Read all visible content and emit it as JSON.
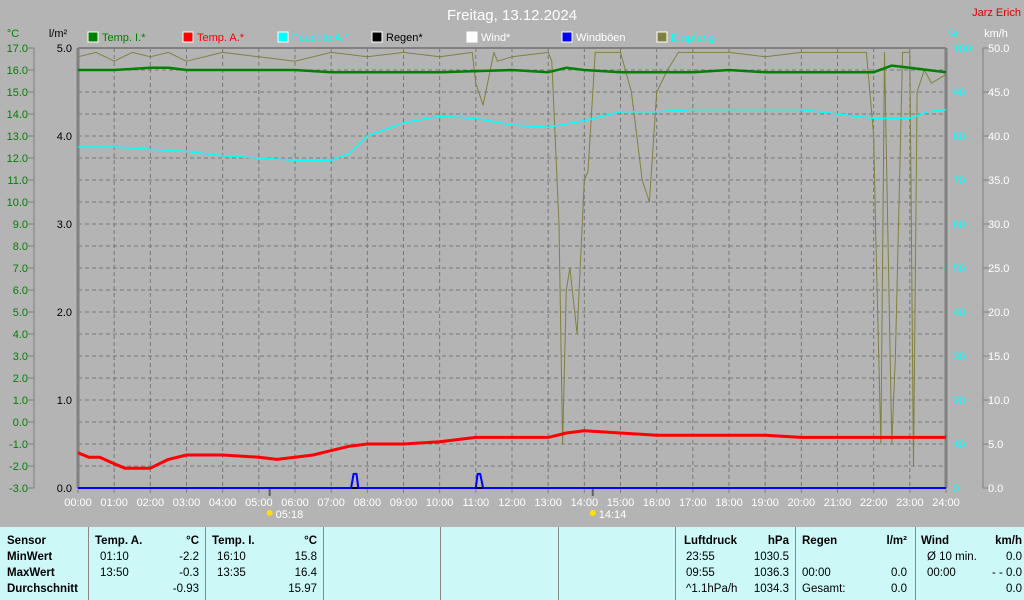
{
  "title": "Freitag, 13.12.2024",
  "author": "Jarz Erich",
  "colors": {
    "temp_i": "#008000",
    "temp_a": "#ff0000",
    "feuchte": "#00ffff",
    "regen": "#000000",
    "wind": "#ffffff",
    "windboeen": "#0000ff",
    "empfang": "#808040"
  },
  "chart_data": {
    "type": "line",
    "title": "Freitag, 13.12.2024",
    "x_range_hours": [
      0,
      24
    ],
    "x_ticks": [
      "00:00",
      "01:00",
      "02:00",
      "03:00",
      "04:00",
      "05:00",
      "06:00",
      "07:00",
      "08:00",
      "09:00",
      "10:00",
      "11:00",
      "12:00",
      "13:00",
      "14:00",
      "15:00",
      "16:00",
      "17:00",
      "18:00",
      "19:00",
      "20:00",
      "21:00",
      "22:00",
      "23:00",
      "24:00"
    ],
    "axes": {
      "temp": {
        "unit": "°C",
        "range": [
          -3,
          17
        ],
        "ticks": [
          "17.0",
          "16.0",
          "15.0",
          "14.0",
          "13.0",
          "12.0",
          "11.0",
          "10.0",
          "9.0",
          "8.0",
          "7.0",
          "6.0",
          "5.0",
          "4.0",
          "3.0",
          "2.0",
          "1.0",
          "0.0",
          "-1.0",
          "-2.0",
          "-3.0"
        ]
      },
      "rain": {
        "unit": "l/m²",
        "range": [
          0,
          5
        ],
        "ticks": [
          "5.0",
          "4.0",
          "3.0",
          "2.0",
          "1.0",
          "0.0"
        ]
      },
      "humidity": {
        "unit": "%",
        "range": [
          0,
          100
        ],
        "ticks": [
          "100",
          "90",
          "80",
          "70",
          "60",
          "50",
          "40",
          "30",
          "20",
          "10",
          "0"
        ]
      },
      "wind": {
        "unit": "km/h",
        "range": [
          0,
          50
        ],
        "ticks": [
          "50.0",
          "45.0",
          "40.0",
          "35.0",
          "30.0",
          "25.0",
          "20.0",
          "15.0",
          "10.0",
          "5.0",
          "0.0"
        ]
      }
    },
    "legend": [
      "Temp. I.*",
      "Temp. A.*",
      "Feuchte A.*",
      "Regen*",
      "Wind*",
      "Windböen",
      "Empfang"
    ],
    "sunrise": "05:18",
    "sunset": "14:14",
    "series": [
      {
        "name": "Temp. I.*",
        "axis": "temp",
        "x": [
          0,
          1,
          2,
          2.5,
          3,
          4,
          5,
          6,
          7,
          8,
          10,
          12,
          13,
          13.5,
          14,
          15,
          16,
          17,
          18,
          19,
          20,
          21,
          22,
          22.5,
          23,
          24
        ],
        "y": [
          16.0,
          16.0,
          16.1,
          16.1,
          16.0,
          16.0,
          16.0,
          16.0,
          15.9,
          15.9,
          15.9,
          16.0,
          15.9,
          16.1,
          16.0,
          15.9,
          15.9,
          15.9,
          16.0,
          15.9,
          15.9,
          15.9,
          15.9,
          16.2,
          16.1,
          15.9
        ]
      },
      {
        "name": "Temp. A.*",
        "axis": "temp",
        "x": [
          0,
          0.3,
          0.6,
          1,
          1.3,
          2,
          2.5,
          3,
          4,
          5,
          5.5,
          6,
          6.5,
          7,
          7.5,
          8,
          9,
          10,
          11,
          12,
          13,
          13.5,
          14,
          15,
          16,
          17,
          18,
          19,
          20,
          21,
          22,
          23,
          24
        ],
        "y": [
          -1.4,
          -1.6,
          -1.6,
          -1.9,
          -2.1,
          -2.1,
          -1.7,
          -1.5,
          -1.5,
          -1.6,
          -1.7,
          -1.6,
          -1.5,
          -1.3,
          -1.1,
          -1.0,
          -1.0,
          -0.9,
          -0.7,
          -0.7,
          -0.7,
          -0.5,
          -0.4,
          -0.5,
          -0.6,
          -0.6,
          -0.6,
          -0.6,
          -0.7,
          -0.7,
          -0.7,
          -0.7,
          -0.7
        ]
      },
      {
        "name": "Feuchte A.*",
        "axis": "humidity",
        "x": [
          0,
          1,
          2,
          3,
          4,
          5,
          6,
          7,
          7.5,
          8,
          9,
          10,
          11,
          12,
          13,
          14,
          15,
          16,
          17,
          18,
          19,
          20,
          21,
          22,
          23,
          23.5,
          24
        ],
        "y": [
          77.5,
          77.5,
          77,
          76.5,
          75.5,
          75,
          74.5,
          74.5,
          76,
          80,
          83,
          84.5,
          84,
          82.5,
          82,
          83.5,
          85.5,
          85.5,
          86,
          86,
          86,
          86,
          85,
          84,
          84,
          85.5,
          86
        ]
      },
      {
        "name": "Regen*",
        "axis": "rain",
        "x": [
          0,
          24
        ],
        "y": [
          0,
          0
        ]
      },
      {
        "name": "Wind*",
        "axis": "wind",
        "x": [
          0,
          24
        ],
        "y": [
          0,
          0
        ]
      },
      {
        "name": "Windböen",
        "axis": "wind",
        "x": [
          0,
          7.55,
          7.62,
          7.7,
          7.75,
          11.0,
          11.05,
          11.12,
          11.2,
          24
        ],
        "y": [
          0,
          0,
          1.6,
          1.6,
          0,
          0,
          1.6,
          1.6,
          0,
          0
        ]
      },
      {
        "name": "Empfang",
        "axis": "humidity",
        "x": [
          0,
          0.5,
          1,
          1.5,
          2,
          2.5,
          3,
          4,
          5,
          6,
          7,
          8,
          9,
          10,
          10.9,
          11,
          11.2,
          11.5,
          11.6,
          12,
          13,
          13.1,
          13.3,
          13.4,
          13.5,
          13.6,
          13.8,
          14,
          14.1,
          14.3,
          14.5,
          14.8,
          15,
          15.3,
          15.6,
          15.8,
          16,
          16.3,
          16.6,
          17,
          18,
          19,
          20,
          21,
          21.8,
          22,
          22.05,
          22.2,
          22.3,
          22.5,
          22.6,
          22.8,
          23,
          23.1,
          23.2,
          23.4,
          23.6,
          24
        ],
        "y": [
          98,
          99,
          97,
          99,
          98,
          99,
          97,
          99,
          98,
          97,
          99,
          98,
          99,
          98,
          99,
          92,
          87,
          99,
          97,
          98,
          99,
          97,
          60,
          10,
          45,
          50,
          35,
          70,
          72,
          99,
          99,
          99,
          99,
          90,
          70,
          65,
          90,
          95,
          99,
          99,
          99,
          98,
          99,
          99,
          99,
          80,
          60,
          10,
          99,
          10,
          30,
          99,
          99,
          5,
          90,
          95,
          92,
          94
        ]
      }
    ]
  },
  "table": {
    "sensor": {
      "header": "Sensor",
      "rows": [
        "MinWert",
        "MaxWert",
        "Durchschnitt"
      ]
    },
    "temp_a": {
      "header": "Temp. A.",
      "unit": "°C",
      "times": [
        "01:10",
        "13:50",
        ""
      ],
      "values": [
        "-2.2",
        "-0.3",
        "-0.93"
      ]
    },
    "temp_i": {
      "header": "Temp. I.",
      "unit": "°C",
      "times": [
        "16:10",
        "13:35",
        ""
      ],
      "values": [
        "15.8",
        "16.4",
        "15.97"
      ]
    },
    "luftdruck": {
      "header": "Luftdruck",
      "unit": "hPa",
      "times": [
        "23:55",
        "09:55",
        "^1.1hPa/h"
      ],
      "values": [
        "1030.5",
        "1036.3",
        "1034.3"
      ]
    },
    "regen": {
      "header": "Regen",
      "unit": "l/m²",
      "times": [
        "",
        "00:00",
        "Gesamt:"
      ],
      "values": [
        "",
        "0.0",
        "0.0"
      ]
    },
    "wind": {
      "header": "Wind",
      "unit": "km/h",
      "times": [
        "Ø 10 min.",
        "00:00",
        ""
      ],
      "values": [
        "0.0",
        "- - 0.0",
        "0.0"
      ]
    }
  }
}
